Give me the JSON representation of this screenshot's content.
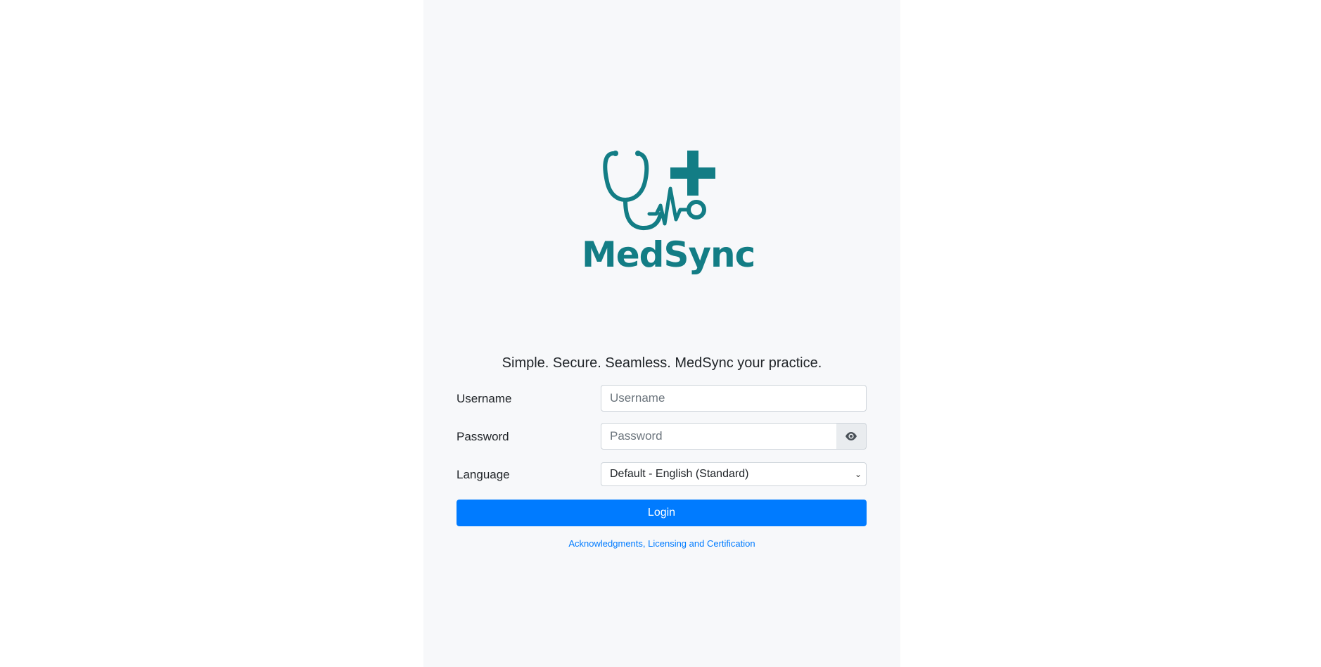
{
  "brand": {
    "name": "MedSync",
    "color": "#137d85"
  },
  "tagline": "Simple. Secure. Seamless. MedSync your practice.",
  "form": {
    "username": {
      "label": "Username",
      "placeholder": "Username",
      "value": ""
    },
    "password": {
      "label": "Password",
      "placeholder": "Password",
      "value": "",
      "toggle_icon": "eye-icon"
    },
    "language": {
      "label": "Language",
      "selected": "Default - English (Standard)"
    },
    "login_label": "Login"
  },
  "footer": {
    "link_text": "Acknowledgments, Licensing and Certification"
  },
  "colors": {
    "primary": "#007bff",
    "panel_bg": "#f7f8fa"
  }
}
